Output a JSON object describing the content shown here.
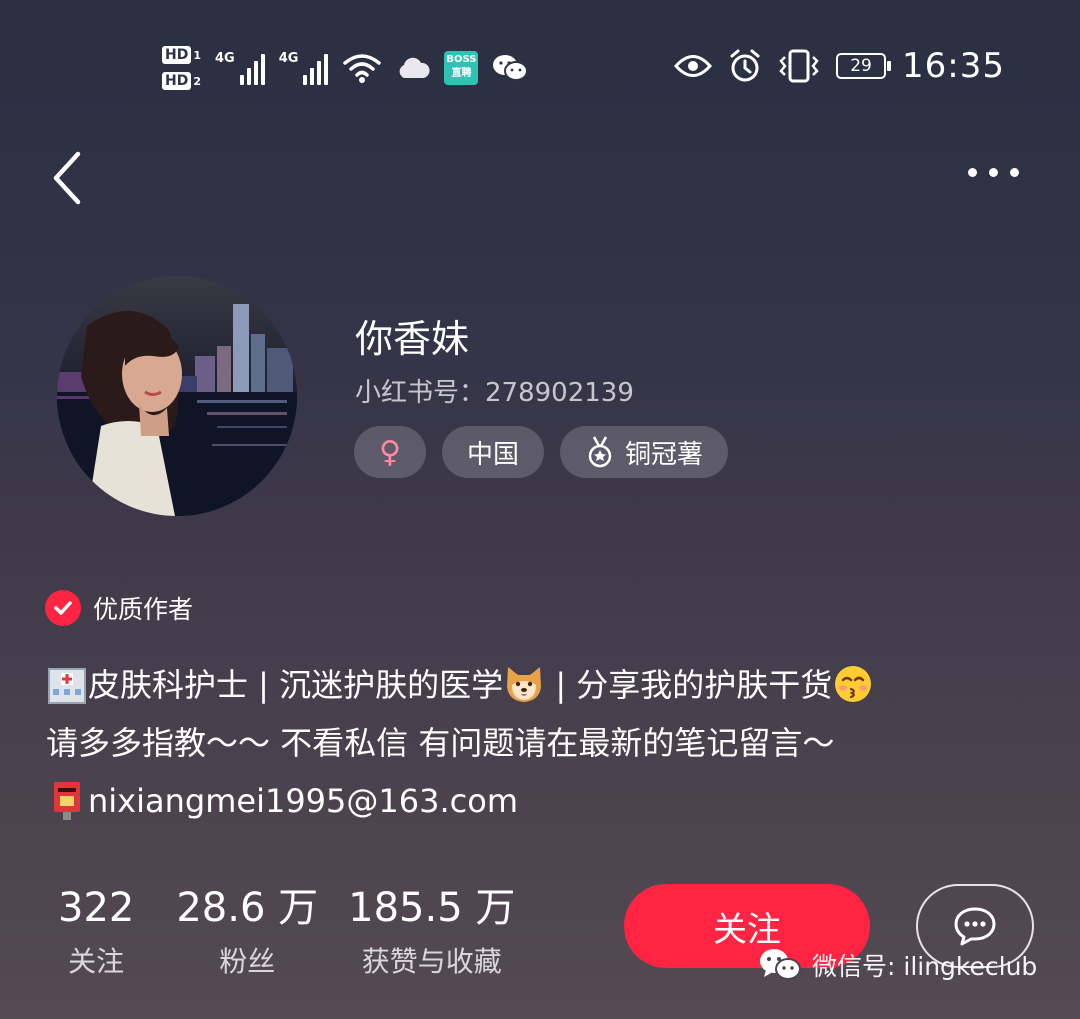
{
  "status_bar": {
    "sim1": "HD",
    "sim1_num": "1",
    "sim2": "HD",
    "sim2_num": "2",
    "net1": "4G",
    "net2": "4G",
    "boss_app": "BOSS 直聘",
    "battery": "29",
    "time": "16:35",
    "icons": [
      "wifi-icon",
      "cloud-icon",
      "boss-zhipin-icon",
      "wechat-icon",
      "eye-icon",
      "alarm-icon",
      "vibrate-icon",
      "battery-icon"
    ]
  },
  "nav": {
    "back_icon": "chevron-left-icon",
    "more_icon": "more-dots-icon"
  },
  "profile": {
    "nickname": "你香妹",
    "red_id": "小红书号：278902139",
    "tags": {
      "gender": "♀",
      "region": "中国",
      "level": "铜冠薯"
    },
    "badge": "优质作者"
  },
  "bio": {
    "line1_a": "皮肤科护士 | 沉迷护肤的医学",
    "line1_b": " | 分享我的护肤干货",
    "line2": "请多多指教～～ 不看私信 有问题请在最新的笔记留言～",
    "line3": "nixiangmei1995@163.com",
    "emojis": [
      "hospital-emoji",
      "shiba-dog-emoji",
      "kissing-face-emoji",
      "postbox-emoji"
    ]
  },
  "stats": [
    {
      "value": "322",
      "label": "关注"
    },
    {
      "value": "28.6 万",
      "label": "粉丝"
    },
    {
      "value": "185.5 万",
      "label": "获赞与收藏"
    }
  ],
  "actions": {
    "follow_label": "关注",
    "chat_icon": "chat-bubble-icon"
  },
  "watermark": {
    "text": "微信号: ilingkeclub"
  },
  "colors": {
    "accent": "#ff2442",
    "gender": "#ff8aa0"
  }
}
